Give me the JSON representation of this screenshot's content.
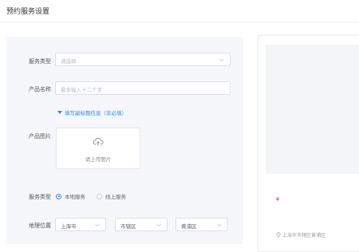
{
  "header": {
    "title": "预约服务设置"
  },
  "form": {
    "service_type": {
      "label": "服务类型",
      "placeholder": "请选择"
    },
    "product_name": {
      "label": "产品名称",
      "placeholder": "最多输入十二个字"
    },
    "more_toggle": "填写副标题信息（非必填）",
    "product_image": {
      "label": "产品图片",
      "upload_text": "请上传图片"
    },
    "service_mode": {
      "label": "服务类型",
      "options": [
        "本地服务",
        "线上服务"
      ],
      "selected_index": 0
    },
    "location": {
      "label": "地理位置",
      "province": "上海市",
      "district": "市辖区",
      "area": "黄浦区"
    }
  },
  "preview": {
    "price_symbol": "¥",
    "address": "上海市市辖区黄浦区"
  },
  "colors": {
    "accent": "#2d8cf0",
    "price": "#f5222d",
    "panel_bg": "#f5f7fa"
  },
  "icons": {
    "chevron": "chevron-down-icon",
    "upload": "cloud-upload-icon",
    "location": "location-pin-icon"
  }
}
